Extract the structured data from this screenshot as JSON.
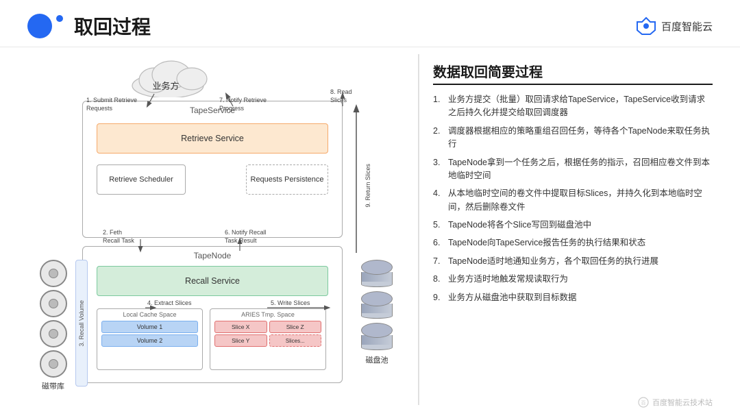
{
  "header": {
    "title": "取回过程",
    "logo_text": "百度智能云"
  },
  "diagram": {
    "cloud_label": "业务方",
    "tape_service_label": "TapeService",
    "retrieve_service_label": "Retrieve Service",
    "retrieve_scheduler_label": "Retrieve Scheduler",
    "requests_persistence_label": "Requests Persistence",
    "tape_node_label": "TapeNode",
    "recall_service_label": "Recall Service",
    "local_cache_label": "Local Cache Space",
    "volume1_label": "Volume 1",
    "volume2_label": "Volume 2",
    "aries_label": "ARIES Tmp. Space",
    "slice_x_label": "Slice X",
    "slice_z_label": "Slice Z",
    "slice_y_label": "Slice Y",
    "slices_label": "Slices...",
    "tape_library_label": "磁带库",
    "disk_pool_label": "磁盘池",
    "recall_volume_label": "3. Recall Volume",
    "arrows": {
      "a1": "1. Submit Retrieve",
      "a1b": "Requests",
      "a2": "7. Notify Retrieve",
      "a2b": "Progress",
      "a3": "8. Read",
      "a3b": "Slices",
      "a4": "2. Feth",
      "a4b": "Recall Task",
      "a5": "6. Notify Recall",
      "a5b": "Task Result",
      "a6": "4. Extract Slices",
      "a7": "5. Write Slices",
      "a8": "9. Return Slices"
    }
  },
  "right_panel": {
    "title": "数据取回简要过程",
    "steps": [
      {
        "num": "1.",
        "text": "业务方提交（批量）取回请求给TapeService，TapeService收到请求之后持久化并提交给取回调度器"
      },
      {
        "num": "2.",
        "text": "调度器根据相应的策略重组召回任务，等待各个TapeNode来取任务执行"
      },
      {
        "num": "3.",
        "text": "TapeNode拿到一个任务之后，根据任务的指示，召回相应卷文件到本地临时空间"
      },
      {
        "num": "4.",
        "text": "从本地临时空间的卷文件中提取目标Slices，并持久化到本地临时空间，然后删除卷文件"
      },
      {
        "num": "5.",
        "text": "TapeNode将各个Slice写回到磁盘池中"
      },
      {
        "num": "6.",
        "text": "TapeNode向TapeService报告任务的执行结果和状态"
      },
      {
        "num": "7.",
        "text": "TapeNode适时地通知业务方，各个取回任务的执行进展"
      },
      {
        "num": "8.",
        "text": "业务方适时地触发常规读取行为"
      },
      {
        "num": "9.",
        "text": "业务方从磁盘池中获取到目标数据"
      }
    ]
  },
  "watermark": {
    "text": "百度智能云技术站"
  }
}
